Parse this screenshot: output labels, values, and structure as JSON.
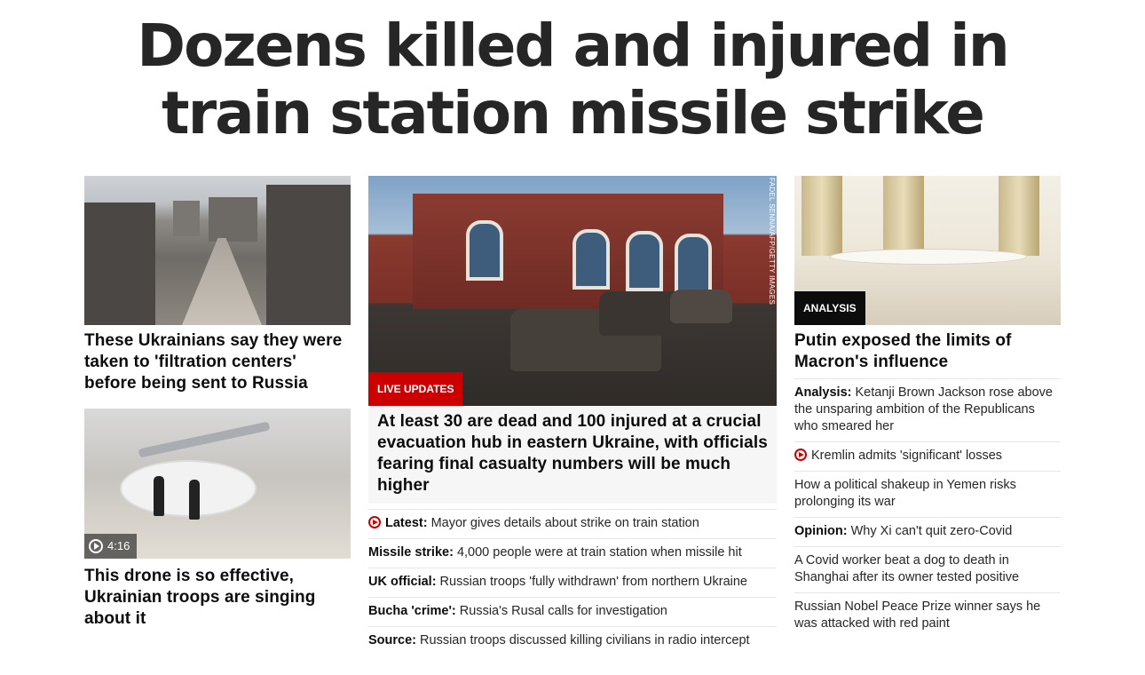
{
  "headline": "Dozens killed and injured in train station missile strike",
  "left": {
    "story1": {
      "title": "These Ukrainians say they were taken to 'filtration centers' before being sent to Russia"
    },
    "story2": {
      "duration": "4:16",
      "title": "This drone is so effective, Ukrainian troops are singing about it"
    }
  },
  "middle": {
    "photo_credit": "FADEL SENNA/AFP/GETTY IMAGES",
    "badge": "LIVE UPDATES",
    "title": "At least 30 are dead and 100 injured at a crucial evacuation hub in eastern Ukraine, with officials fearing final casualty numbers will be much higher",
    "items": [
      {
        "prefix": "Latest:",
        "text": " Mayor gives details about strike on train station"
      },
      {
        "prefix": "Missile strike:",
        "text": " 4,000 people were at train station when missile hit"
      },
      {
        "prefix": "UK official:",
        "text": " Russian troops 'fully withdrawn' from northern Ukraine"
      },
      {
        "prefix": "Bucha 'crime':",
        "text": " Russia's Rusal calls for investigation"
      },
      {
        "prefix": "Source:",
        "text": " Russian troops discussed killing civilians in radio intercept"
      }
    ]
  },
  "right": {
    "badge": "ANALYSIS",
    "title": "Putin exposed the limits of Macron's influence",
    "items": [
      {
        "prefix": "Analysis:",
        "text": " Ketanji Brown Jackson rose above the unsparing ambition of the Republicans who smeared her"
      },
      {
        "prefix": "",
        "text": "Kremlin admits 'significant' losses"
      },
      {
        "prefix": "",
        "text": "How a political shakeup in Yemen risks prolonging its war"
      },
      {
        "prefix": "Opinion:",
        "text": " Why Xi can't quit zero-Covid"
      },
      {
        "prefix": "",
        "text": "A Covid worker beat a dog to death in Shanghai after its owner tested positive"
      },
      {
        "prefix": "",
        "text": "Russian Nobel Peace Prize winner says he was attacked with red paint"
      }
    ]
  },
  "colors": {
    "live": "#cc0000",
    "analysis": "#0c0c0c",
    "text": "#0c0c0c"
  }
}
